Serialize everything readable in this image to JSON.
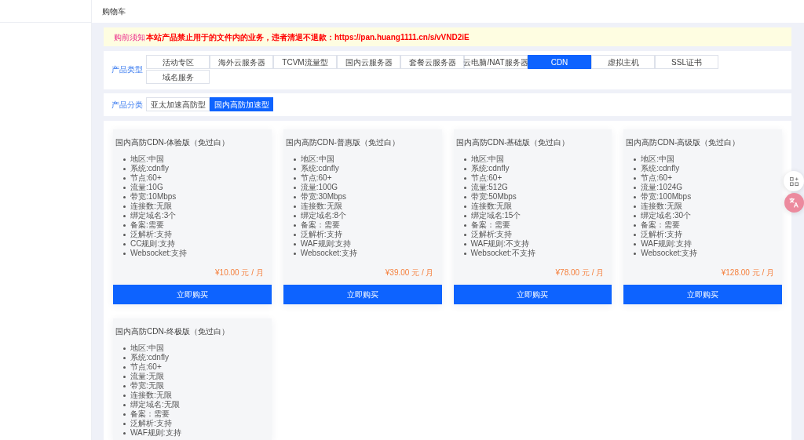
{
  "header": {
    "title": "购物车"
  },
  "notice": {
    "label": "购前须知",
    "text": "本站产品禁止用于的文件内的业务，违者清退不退款：https://pan.huang1111.cn/s/vVND2iE"
  },
  "product_type": {
    "label": "产品类型",
    "tabs": [
      {
        "label": "活动专区",
        "selected": false
      },
      {
        "label": "海外云服务器",
        "selected": false
      },
      {
        "label": "TCVM流量型",
        "selected": false
      },
      {
        "label": "国内云服务器",
        "selected": false
      },
      {
        "label": "套餐云服务器",
        "selected": false
      },
      {
        "label": "云电脑/NAT服务器",
        "selected": false
      },
      {
        "label": "CDN",
        "selected": true
      },
      {
        "label": "虚拟主机",
        "selected": false
      },
      {
        "label": "SSL证书",
        "selected": false
      },
      {
        "label": "域名服务",
        "selected": false
      }
    ]
  },
  "product_category": {
    "label": "产品分类",
    "tabs": [
      {
        "label": "亚太加速高防型",
        "selected": false
      },
      {
        "label": "国内高防加速型",
        "selected": true
      }
    ]
  },
  "products": [
    {
      "name": "国内高防CDN-体验版（免过白）",
      "features": [
        "地区:中国",
        "系统:cdnfly",
        "节点:60+",
        "流量:10G",
        "带宽:10Mbps",
        "连接数:无限",
        "绑定域名:3个",
        "备案:需要",
        "泛解析:支持",
        "CC规则:支持",
        "Websocket:支持"
      ],
      "price": "¥10.00 元 / 月",
      "button": "立即购买"
    },
    {
      "name": "国内高防CDN-普惠版（免过白）",
      "features": [
        "地区:中国",
        "系统:cdnfly",
        "节点:60+",
        "流量:100G",
        "带宽:30Mbps",
        "连接数:无限",
        "绑定域名:8个",
        "备案：需要",
        "泛解析:支持",
        "WAF规则:支持",
        "Websocket:支持"
      ],
      "price": "¥39.00 元 / 月",
      "button": "立即购买"
    },
    {
      "name": "国内高防CDN-基础版（免过白）",
      "features": [
        "地区:中国",
        "系统:cdnfly",
        "节点:60+",
        "流量:512G",
        "带宽:50Mbps",
        "连接数:无限",
        "绑定域名:15个",
        "备案：需要",
        "泛解析:支持",
        "WAF规则:不支持",
        "Websocket:不支持"
      ],
      "price": "¥78.00 元 / 月",
      "button": "立即购买"
    },
    {
      "name": "国内高防CDN-高级版（免过白）",
      "features": [
        "地区:中国",
        "系统:cdnfly",
        "节点:60+",
        "流量:1024G",
        "带宽:100Mbps",
        "连接数:无限",
        "绑定域名:30个",
        "备案：需要",
        "泛解析:支持",
        "WAF规则:支持",
        "Websocket:支持"
      ],
      "price": "¥128.00 元 / 月",
      "button": "立即购买"
    },
    {
      "name": "国内高防CDN-终极版（免过白）",
      "features": [
        "地区:中国",
        "系统:cdnfly",
        "节点:60+",
        "流量:无限",
        "带宽:无限",
        "连接数:无限",
        "绑定域名:无限",
        "备案：需要",
        "泛解析:支持",
        "WAF规则:支持"
      ]
    }
  ]
}
